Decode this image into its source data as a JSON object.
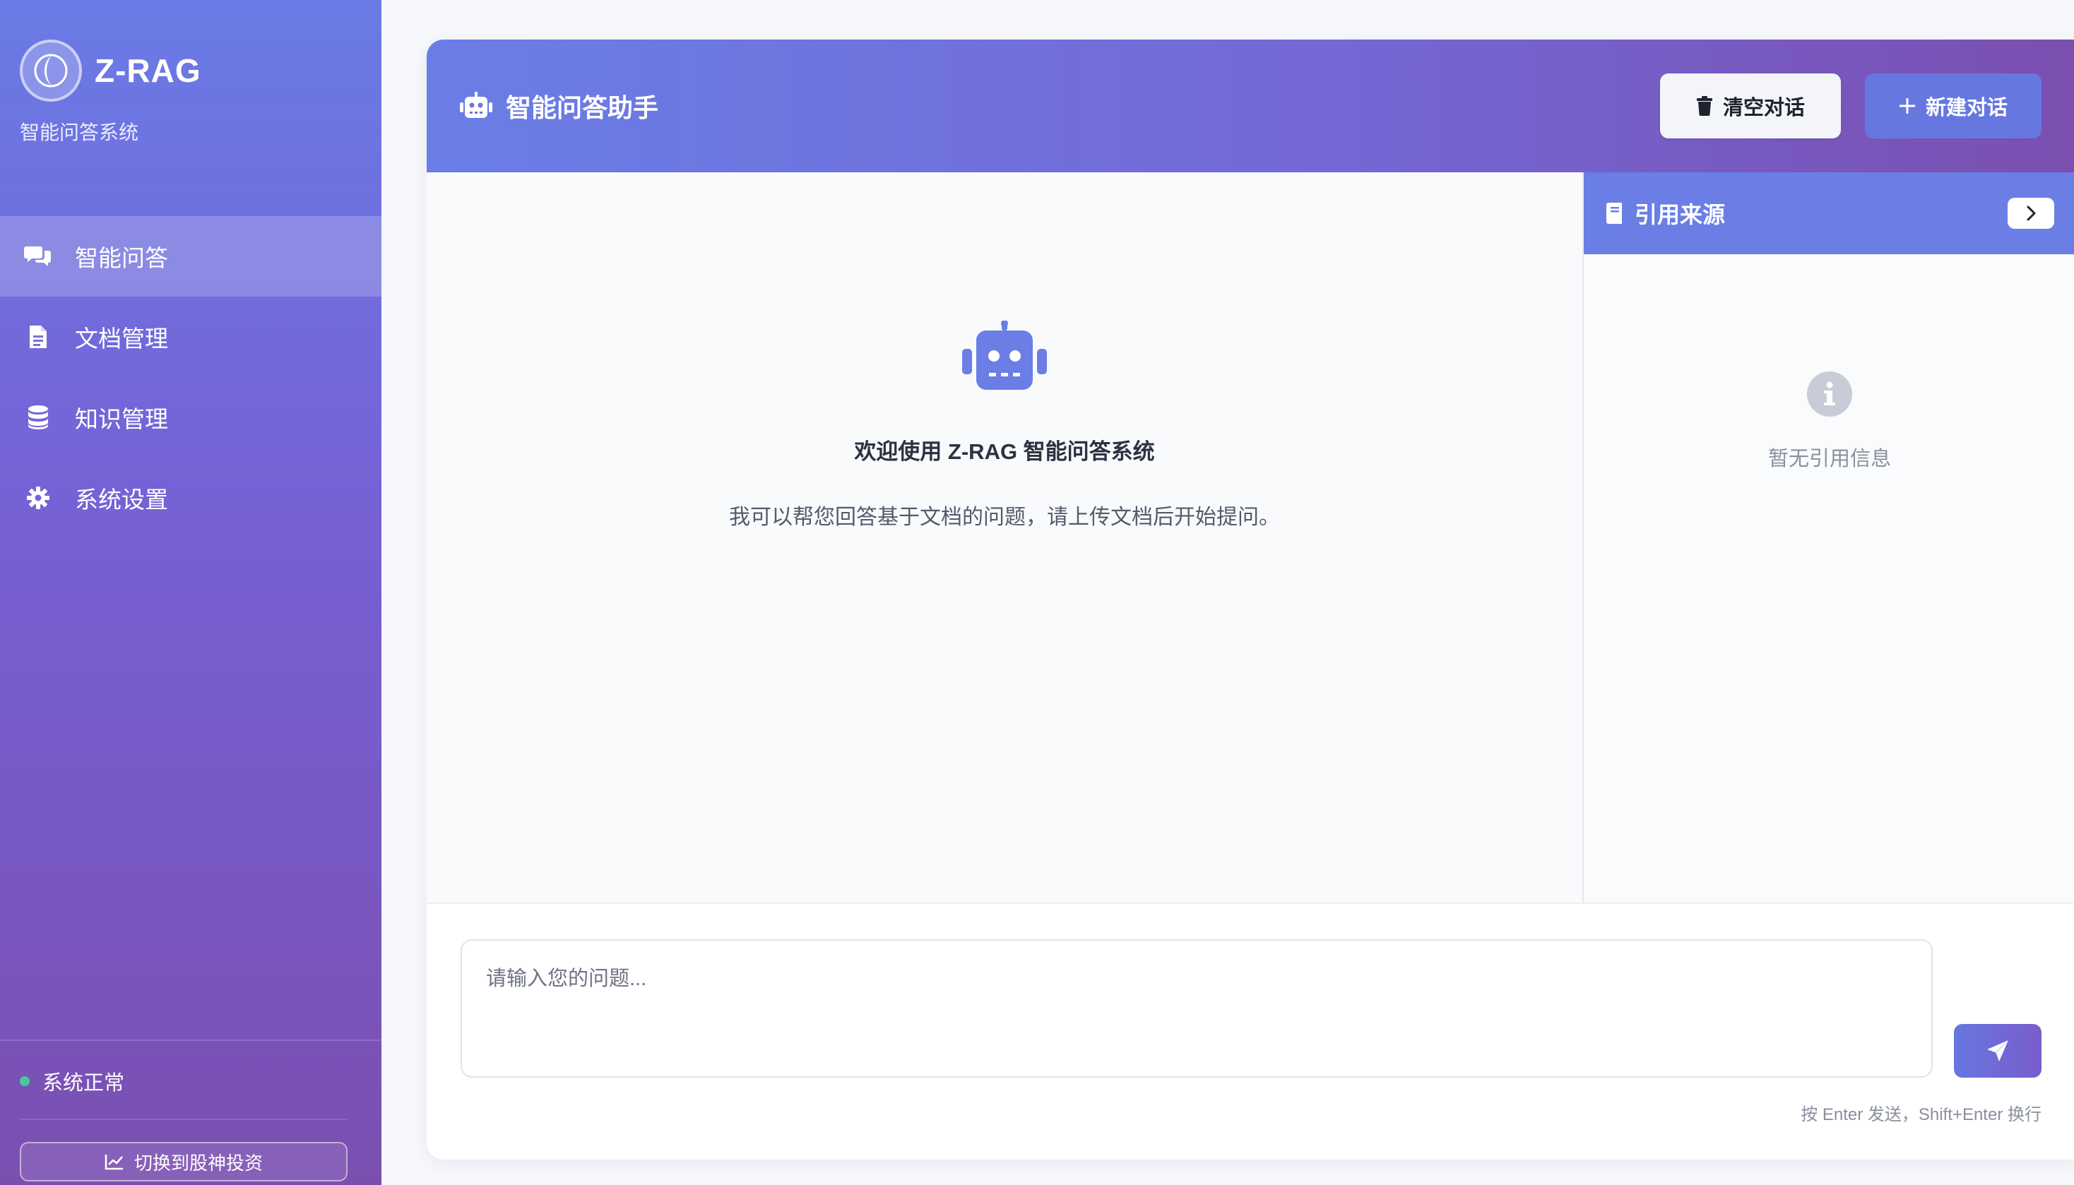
{
  "brand": {
    "name": "Z-RAG",
    "subtitle": "智能问答系统"
  },
  "nav": {
    "items": [
      {
        "label": "智能问答",
        "icon": "chat-bubbles-icon",
        "active": true
      },
      {
        "label": "文档管理",
        "icon": "document-icon",
        "active": false
      },
      {
        "label": "知识管理",
        "icon": "database-icon",
        "active": false
      },
      {
        "label": "系统设置",
        "icon": "gear-icon",
        "active": false
      }
    ]
  },
  "status": {
    "label": "系统正常",
    "color": "#48c8a0"
  },
  "switch_button": {
    "label": "切换到股神投资",
    "icon": "line-chart-icon"
  },
  "header": {
    "title": "智能问答助手",
    "icon": "robot-icon",
    "clear_label": "清空对话",
    "clear_icon": "trash-icon",
    "new_label": "新建对话",
    "new_icon": "plus-icon"
  },
  "welcome": {
    "title": "欢迎使用 Z-RAG 智能问答系统",
    "description": "我可以帮您回答基于文档的问题，请上传文档后开始提问。"
  },
  "citations": {
    "title": "引用来源",
    "icon": "book-icon",
    "toggle_icon": "chevron-right-icon",
    "empty_text": "暂无引用信息",
    "empty_icon": "info-icon"
  },
  "input": {
    "placeholder": "请输入您的问题...",
    "value": "",
    "send_icon": "paper-plane-icon",
    "hint": "按 Enter 发送，Shift+Enter 换行"
  },
  "colors": {
    "accent": "#6a7ee6",
    "accent_purple": "#7a4fb0",
    "status_ok": "#48c8a0"
  }
}
